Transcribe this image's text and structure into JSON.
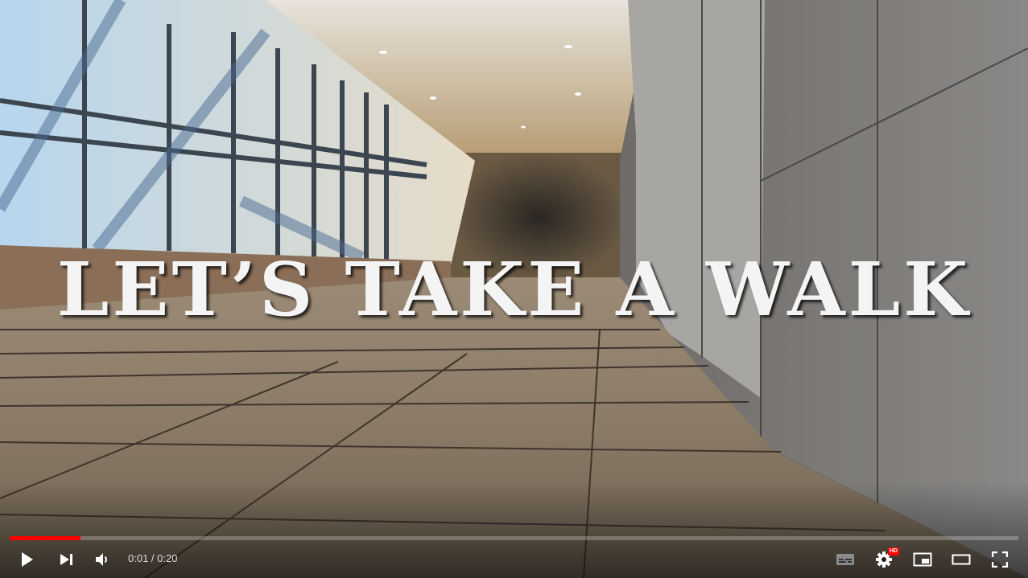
{
  "video": {
    "overlay_title": "LET’S TAKE A WALK",
    "progress_fraction": 0.07
  },
  "controls": {
    "current_time": "0:01",
    "separator": " / ",
    "duration": "0:20",
    "hd_badge": "HD"
  },
  "colors": {
    "progress_played": "#ff0000",
    "progress_track": "rgba(255,255,255,0.25)",
    "icon": "#ffffff"
  },
  "icons": [
    "play-icon",
    "next-icon",
    "volume-icon",
    "subtitles-icon",
    "settings-icon",
    "miniplayer-icon",
    "theater-icon",
    "fullscreen-icon"
  ]
}
